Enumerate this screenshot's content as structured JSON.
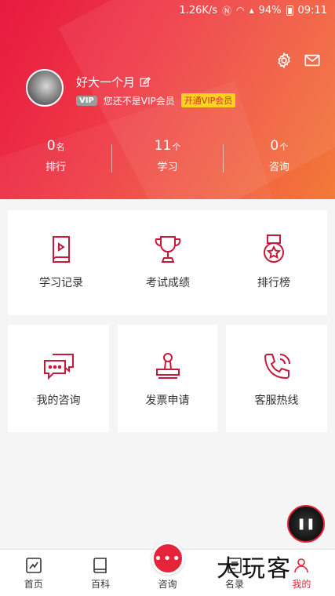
{
  "status_bar": {
    "speed": "1.26K/s",
    "battery": "94%",
    "time": "09:11"
  },
  "header": {
    "settings_icon": "gear-icon",
    "message_icon": "mail-icon"
  },
  "profile": {
    "username": "好大一个月",
    "vip_tag": "VIP",
    "vip_status": "您还不是VIP会员",
    "vip_open": "开通VIP会员"
  },
  "stats": [
    {
      "num": "0",
      "unit": "名",
      "label": "排行"
    },
    {
      "num": "11",
      "unit": "个",
      "label": "学习"
    },
    {
      "num": "0",
      "unit": "个",
      "label": "咨询"
    }
  ],
  "tiles": [
    {
      "label": "学习记录",
      "icon": "book-icon"
    },
    {
      "label": "考试成绩",
      "icon": "trophy-icon"
    },
    {
      "label": "排行榜",
      "icon": "medal-icon"
    },
    {
      "label": "我的咨询",
      "icon": "chat-icon"
    },
    {
      "label": "发票申请",
      "icon": "stamp-icon"
    },
    {
      "label": "客服热线",
      "icon": "phone-icon"
    }
  ],
  "nav": [
    {
      "label": "首页",
      "icon": "home-icon"
    },
    {
      "label": "百科",
      "icon": "book-icon"
    },
    {
      "label": "咨询",
      "icon": "more-icon"
    },
    {
      "label": "名录",
      "icon": "directory-icon"
    },
    {
      "label": "我的",
      "icon": "user-icon"
    }
  ],
  "colors": {
    "accent": "#e5243b",
    "vip_yellow": "#ffd21f"
  },
  "watermark": "大玩客"
}
